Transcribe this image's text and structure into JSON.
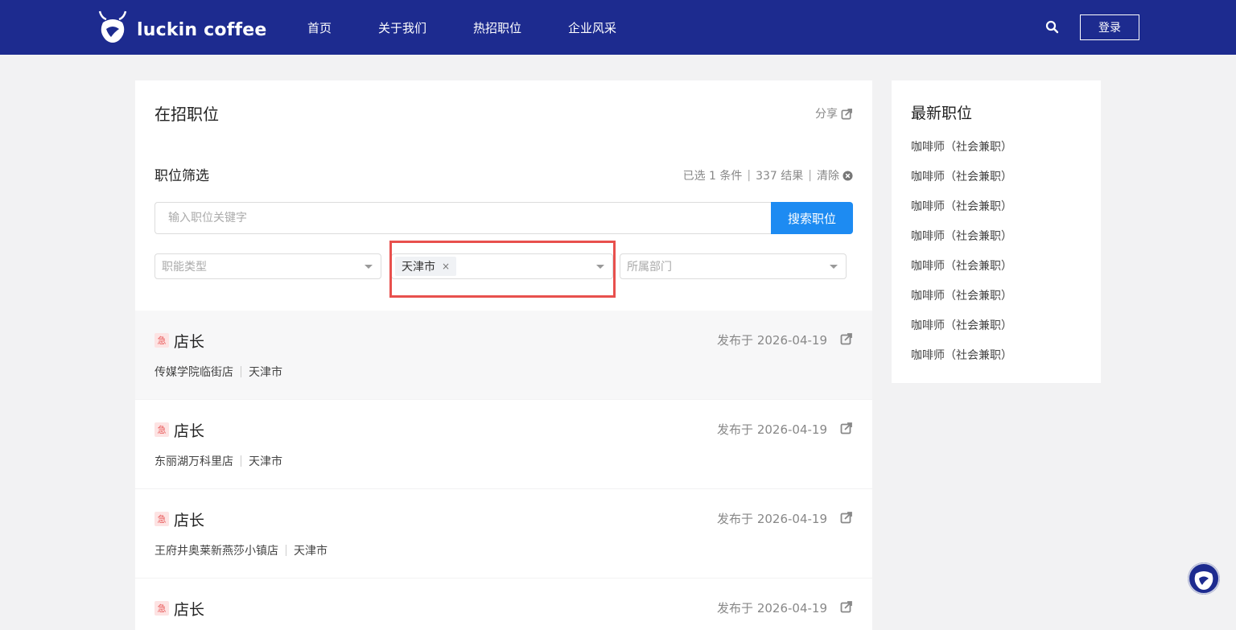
{
  "nav": {
    "brand": "luckin coffee",
    "links": [
      "首页",
      "关于我们",
      "热招职位",
      "企业风采"
    ],
    "login": "登录"
  },
  "main": {
    "title": "在招职位",
    "share": "分享",
    "filter_title": "职位筛选",
    "summary": {
      "selected": "已选 1 条件",
      "results": "337 结果",
      "clear": "清除"
    },
    "search": {
      "placeholder": "输入职位关键字",
      "button": "搜索职位"
    },
    "selects": {
      "function_placeholder": "职能类型",
      "city_tag": "天津市",
      "department_placeholder": "所属部门"
    }
  },
  "jobs": [
    {
      "badge": "急",
      "title": "店长",
      "date": "发布于 2026-04-19",
      "store": "传媒学院临街店",
      "city": "天津市"
    },
    {
      "badge": "急",
      "title": "店长",
      "date": "发布于 2026-04-19",
      "store": "东丽湖万科里店",
      "city": "天津市"
    },
    {
      "badge": "急",
      "title": "店长",
      "date": "发布于 2026-04-19",
      "store": "王府井奥莱新燕莎小镇店",
      "city": "天津市"
    },
    {
      "badge": "急",
      "title": "店长",
      "date": "发布于 2026-04-19",
      "store": "",
      "city": ""
    }
  ],
  "sidebar": {
    "title": "最新职位",
    "items": [
      "咖啡师（社会兼职）",
      "咖啡师（社会兼职）",
      "咖啡师（社会兼职）",
      "咖啡师（社会兼职）",
      "咖啡师（社会兼职）",
      "咖啡师（社会兼职）",
      "咖啡师（社会兼职）",
      "咖啡师（社会兼职）"
    ]
  },
  "colors": {
    "nav": "#1d2b8f",
    "primary_button": "#1d8bf2",
    "highlight": "#e8504d",
    "badge": "#e85a5a"
  },
  "icons": [
    "luckin-logo-icon",
    "search-icon",
    "share-icon",
    "clear-icon",
    "caret-down-icon",
    "close-icon"
  ]
}
